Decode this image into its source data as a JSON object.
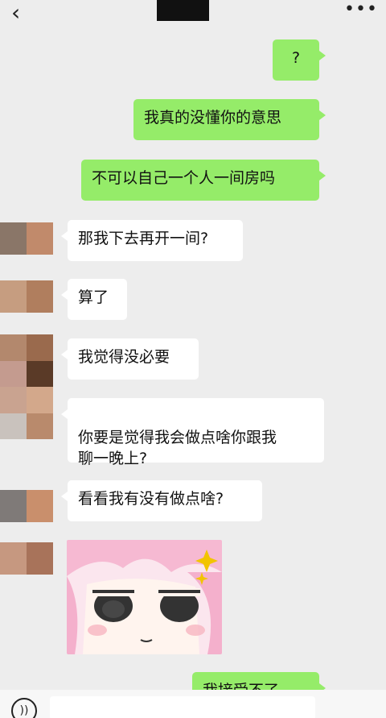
{
  "header": {
    "back_icon": "chevron-left-icon",
    "back_glyph": "‹",
    "more_icon": "more-icon",
    "more_glyph": "•••"
  },
  "messages": [
    {
      "from": "me",
      "text": "?"
    },
    {
      "from": "me",
      "text": "我真的没懂你的意思"
    },
    {
      "from": "me",
      "text": "不可以自己一个人一间房吗"
    },
    {
      "from": "other",
      "text": "那我下去再开一间?"
    },
    {
      "from": "other",
      "text": "算了"
    },
    {
      "from": "other",
      "text": "我觉得没必要"
    },
    {
      "from": "other",
      "text": "你要是觉得我会做点啥你跟我\n聊一晚上?"
    },
    {
      "from": "other",
      "text": "看看我有没有做点啥?"
    },
    {
      "from": "other",
      "type": "sticker",
      "sticker": "anime-girl-sticker"
    },
    {
      "from": "me",
      "text": "我接受不了"
    }
  ],
  "input_bar": {
    "voice_icon": "voice-icon",
    "voice_glyph": "))"
  },
  "colors": {
    "background": "#ededed",
    "me_bubble": "#95ec69",
    "other_bubble": "#ffffff"
  }
}
